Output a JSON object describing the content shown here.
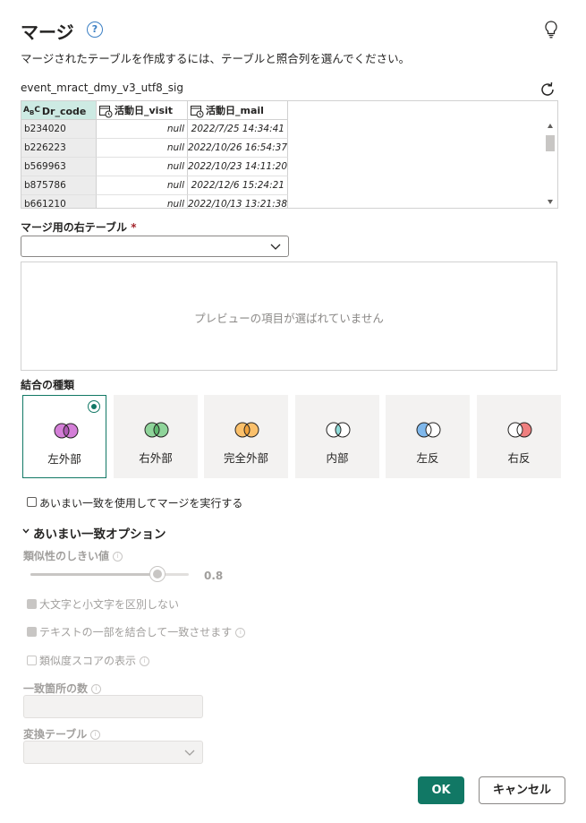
{
  "dialog": {
    "title": "マージ",
    "description": "マージされたテーブルを作成するには、テーブルと照合列を選んでください。"
  },
  "left_table": {
    "name": "event_mract_dmy_v3_utf8_sig",
    "columns": [
      {
        "label": "Dr_code",
        "type_icon": "abc-text-icon"
      },
      {
        "label": "活動日_visit",
        "type_icon": "datetime-icon"
      },
      {
        "label": "活動日_mail",
        "type_icon": "datetime-icon"
      }
    ],
    "rows": [
      [
        "b234020",
        "null",
        "2022/7/25 14:34:41"
      ],
      [
        "b226223",
        "null",
        "2022/10/26 16:54:37"
      ],
      [
        "b569963",
        "null",
        "2022/10/23 14:11:20"
      ],
      [
        "b875786",
        "null",
        "2022/12/6 15:24:21"
      ],
      [
        "b661210",
        "null",
        "2022/10/13 13:21:38"
      ]
    ]
  },
  "right_table": {
    "label": "マージ用の右テーブル",
    "required_mark": "*",
    "selected_value": "",
    "preview_placeholder": "プレビューの項目が選ばれていません"
  },
  "join": {
    "label": "結合の種類",
    "selected_index": 0,
    "kinds": [
      {
        "label": "左外部",
        "icon": "left-outer-join-icon",
        "left": "#d47fd8",
        "right": "#d47fd8",
        "mid": "#b05ab5"
      },
      {
        "label": "右外部",
        "icon": "right-outer-join-icon",
        "left": "#8fd49a",
        "right": "#8fd49a",
        "mid": "#5fb86f"
      },
      {
        "label": "完全外部",
        "icon": "full-outer-join-icon",
        "left": "#fac06b",
        "right": "#fac06b",
        "mid": "#f0a23c"
      },
      {
        "label": "内部",
        "icon": "inner-join-icon",
        "left": "#ffffff",
        "right": "#ffffff",
        "mid": "#8fdbd8"
      },
      {
        "label": "左反",
        "icon": "left-anti-join-icon",
        "left": "#7fb8ec",
        "right": "#ffffff",
        "mid": "#ffffff"
      },
      {
        "label": "右反",
        "icon": "right-anti-join-icon",
        "left": "#ffffff",
        "right": "#ef7f7f",
        "mid": "#ffffff"
      }
    ]
  },
  "fuzzy": {
    "use_label": "あいまい一致を使用してマージを実行する",
    "options_header": "あいまい一致オプション",
    "threshold_label": "類似性のしきい値",
    "threshold_value": "0.8",
    "threshold_fraction": 0.8,
    "ignore_case_label": "大文字と小文字を区別しない",
    "combine_text_label": "テキストの一部を結合して一致させます",
    "show_scores_label": "類似度スコアの表示",
    "max_matches_label": "一致箇所の数",
    "transform_table_label": "変換テーブル"
  },
  "buttons": {
    "ok": "OK",
    "cancel": "キャンセル"
  },
  "colors": {
    "accent": "#117865",
    "selected_column": "#cdeae3"
  }
}
